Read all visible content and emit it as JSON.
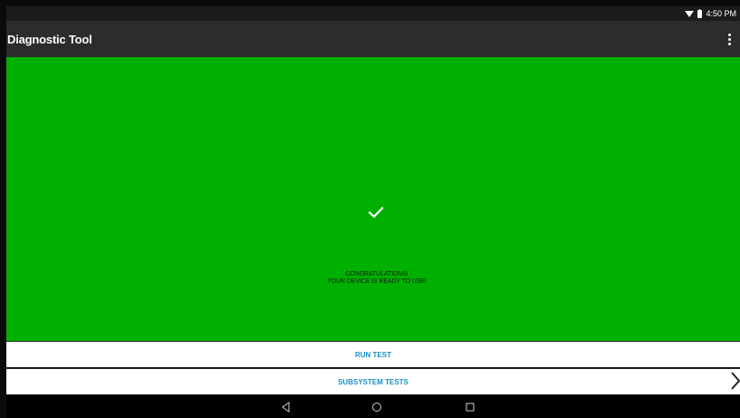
{
  "status_bar": {
    "time": "4:50 PM",
    "icons": [
      "wifi-icon",
      "battery-icon"
    ]
  },
  "app_bar": {
    "title": "Diagnostic Tool",
    "menu_icon": "overflow-menu-icon"
  },
  "result": {
    "icon": "check-icon",
    "background": "#00b000",
    "line1": "CONGRATULATIONS!",
    "line2": "YOUR DEVICE IS READY TO USE!"
  },
  "actions": {
    "run_test": "RUN TEST",
    "subsystem_tests": "SUBSYSTEM TESTS",
    "subsystem_icon": "chevron-right-icon",
    "accent": "#1a8fc7"
  },
  "nav_bar": {
    "back": "back-icon",
    "home": "home-icon",
    "recents": "recents-icon"
  }
}
